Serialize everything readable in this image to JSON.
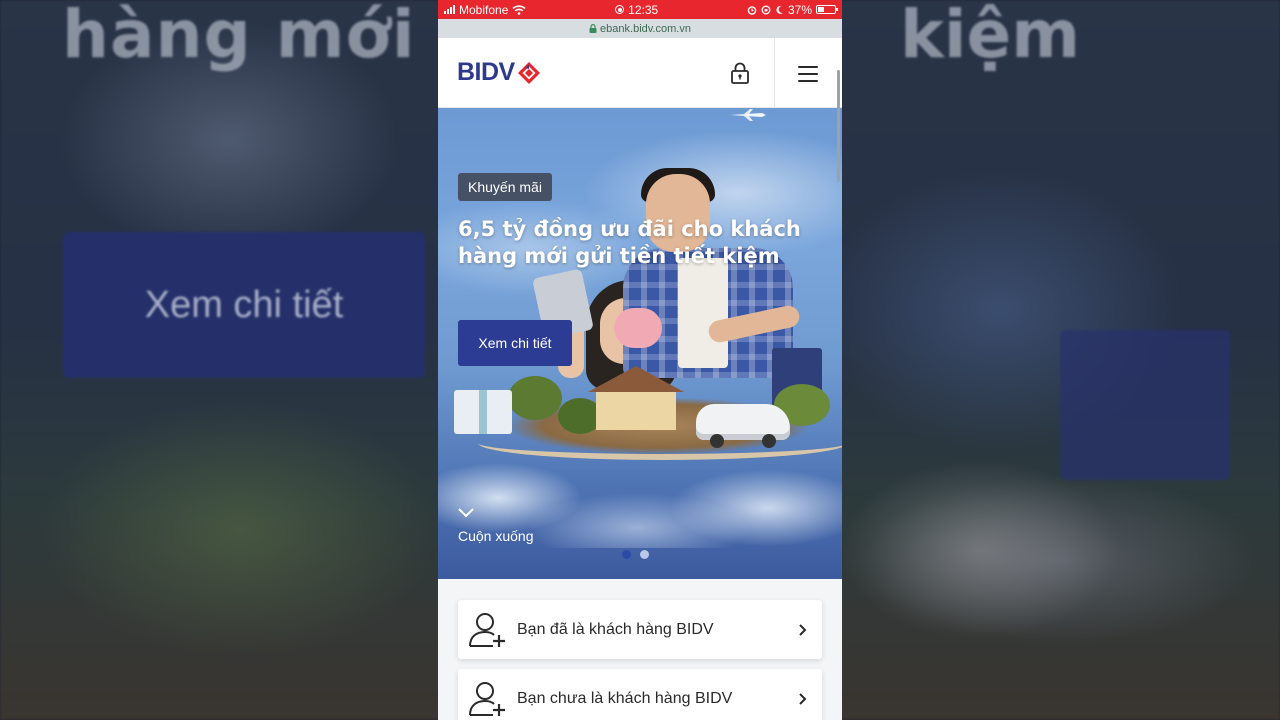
{
  "background": {
    "title_left": "hàng mới g",
    "title_right": "kiệm",
    "button_label": "Xem chi tiết"
  },
  "status_bar": {
    "carrier": "Mobifone",
    "time": "12:35",
    "battery": "37%",
    "battery_level": 0.37,
    "color": "#e8262d"
  },
  "url_bar": {
    "url": "ebank.bidv.com.vn",
    "lock_icon": "lock-icon"
  },
  "header": {
    "logo_text": "BIDV",
    "logo_icon": "bidv-diamond-icon",
    "lock_icon": "lock-icon",
    "menu_icon": "hamburger-menu-icon",
    "brand_color": "#2d3a8c"
  },
  "hero": {
    "badge": "Khuyến mãi",
    "title": "6,5 tỷ đồng ưu đãi cho khách hàng mới gửi tiền tiết kiệm",
    "button_label": "Xem chi tiết",
    "scroll_label": "Cuộn xuống",
    "slides": 2,
    "active_slide": 2,
    "button_color": "#2c3b94"
  },
  "customer_options": [
    {
      "label": "Bạn đã là khách hàng BIDV",
      "icon": "user-add-icon"
    },
    {
      "label": "Bạn chưa là khách hàng BIDV",
      "icon": "user-add-icon"
    }
  ]
}
